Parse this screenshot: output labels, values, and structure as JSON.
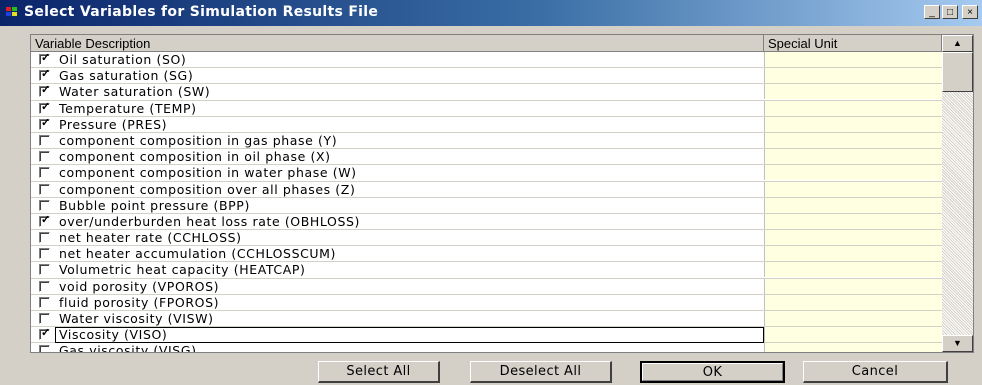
{
  "window": {
    "title": "Select Variables for Simulation Results File",
    "controls": {
      "minimize": "_",
      "maximize": "□",
      "close": "×"
    }
  },
  "grid": {
    "columns": [
      "Variable Description",
      "Special Unit"
    ],
    "rows": [
      {
        "label": "Oil saturation (SO)",
        "checked": true
      },
      {
        "label": "Gas saturation (SG)",
        "checked": true
      },
      {
        "label": "Water saturation (SW)",
        "checked": true
      },
      {
        "label": "Temperature (TEMP)",
        "checked": true
      },
      {
        "label": "Pressure (PRES)",
        "checked": true
      },
      {
        "label": "component composition in gas phase (Y)",
        "checked": false
      },
      {
        "label": "component composition in oil phase (X)",
        "checked": false
      },
      {
        "label": "component composition in water phase (W)",
        "checked": false
      },
      {
        "label": "component composition over all phases (Z)",
        "checked": false
      },
      {
        "label": "Bubble point pressure (BPP)",
        "checked": false
      },
      {
        "label": "over/underburden heat loss rate  (OBHLOSS)",
        "checked": true
      },
      {
        "label": "net heater rate  (CCHLOSS)",
        "checked": false
      },
      {
        "label": "net heater accumulation  (CCHLOSSCUM)",
        "checked": false
      },
      {
        "label": "Volumetric heat capacity  (HEATCAP)",
        "checked": false
      },
      {
        "label": "void porosity (VPOROS)",
        "checked": false
      },
      {
        "label": "fluid porosity (FPOROS)",
        "checked": false
      },
      {
        "label": "Water viscosity (VISW)",
        "checked": false
      },
      {
        "label": "Viscosity (VISO)",
        "checked": true,
        "selected": true
      },
      {
        "label": "Gas viscosity (VISG)",
        "checked": false
      }
    ]
  },
  "buttons": {
    "select_all": "Select All",
    "deselect_all": "Deselect All",
    "ok": "OK",
    "cancel": "Cancel"
  },
  "colors": {
    "title_start": "#0a246a",
    "title_end": "#a6caf0",
    "unit_cell_bg": "#ffffe1",
    "face": "#d4d0c8"
  }
}
